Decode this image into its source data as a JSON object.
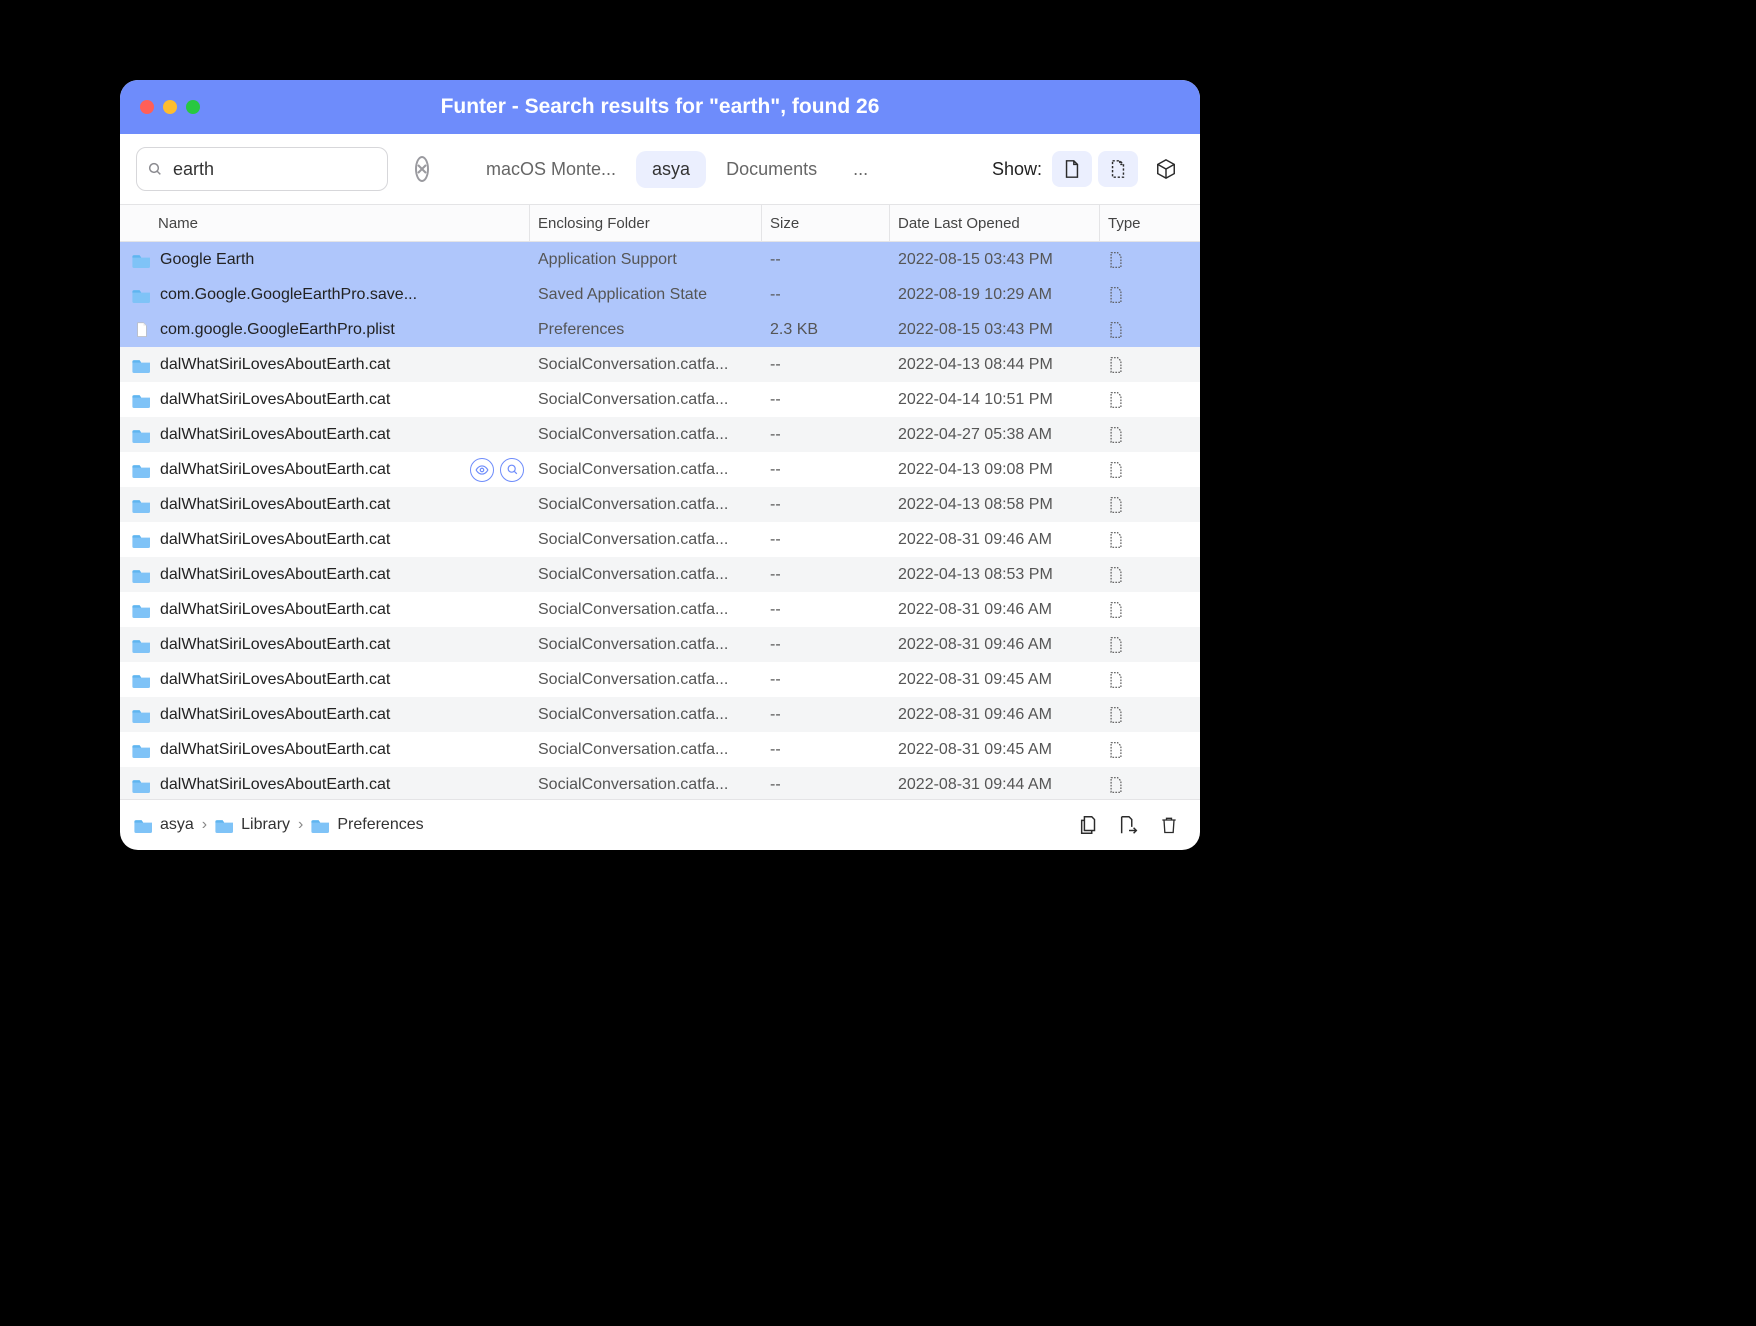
{
  "window": {
    "title": "Funter - Search results for \"earth\", found 26"
  },
  "toolbar": {
    "search_value": "earth",
    "scopes": [
      "macOS Monte...",
      "asya",
      "Documents",
      "..."
    ],
    "active_scope_index": 1,
    "show_label": "Show:"
  },
  "columns": {
    "name": "Name",
    "folder": "Enclosing Folder",
    "size": "Size",
    "date": "Date Last Opened",
    "type": "Type"
  },
  "rows": [
    {
      "icon": "folder",
      "type_icon": "hidden",
      "name": "Google Earth",
      "folder": "Application Support",
      "size": "--",
      "date": "2022-08-15 03:43 PM",
      "selected": true
    },
    {
      "icon": "folder",
      "type_icon": "hidden",
      "name": "com.Google.GoogleEarthPro.save...",
      "folder": "Saved Application State",
      "size": "--",
      "date": "2022-08-19 10:29 AM",
      "selected": true
    },
    {
      "icon": "doc",
      "type_icon": "hidden",
      "name": "com.google.GoogleEarthPro.plist",
      "folder": "Preferences",
      "size": "2.3 KB",
      "date": "2022-08-15 03:43 PM",
      "selected": true
    },
    {
      "icon": "folder",
      "type_icon": "hidden",
      "name": "dalWhatSiriLovesAboutEarth.cat",
      "folder": "SocialConversation.catfa...",
      "size": "--",
      "date": "2022-04-13 08:44 PM"
    },
    {
      "icon": "folder",
      "type_icon": "hidden",
      "name": "dalWhatSiriLovesAboutEarth.cat",
      "folder": "SocialConversation.catfa...",
      "size": "--",
      "date": "2022-04-14 10:51 PM"
    },
    {
      "icon": "folder",
      "type_icon": "hidden",
      "name": "dalWhatSiriLovesAboutEarth.cat",
      "folder": "SocialConversation.catfa...",
      "size": "--",
      "date": "2022-04-27 05:38 AM"
    },
    {
      "icon": "folder",
      "type_icon": "hidden",
      "name": "dalWhatSiriLovesAboutEarth.cat",
      "folder": "SocialConversation.catfa...",
      "size": "--",
      "date": "2022-04-13 09:08 PM",
      "hover": true
    },
    {
      "icon": "folder",
      "type_icon": "hidden",
      "name": "dalWhatSiriLovesAboutEarth.cat",
      "folder": "SocialConversation.catfa...",
      "size": "--",
      "date": "2022-04-13 08:58 PM"
    },
    {
      "icon": "folder",
      "type_icon": "hidden",
      "name": "dalWhatSiriLovesAboutEarth.cat",
      "folder": "SocialConversation.catfa...",
      "size": "--",
      "date": "2022-08-31 09:46 AM"
    },
    {
      "icon": "folder",
      "type_icon": "hidden",
      "name": "dalWhatSiriLovesAboutEarth.cat",
      "folder": "SocialConversation.catfa...",
      "size": "--",
      "date": "2022-04-13 08:53 PM"
    },
    {
      "icon": "folder",
      "type_icon": "hidden",
      "name": "dalWhatSiriLovesAboutEarth.cat",
      "folder": "SocialConversation.catfa...",
      "size": "--",
      "date": "2022-08-31 09:46 AM"
    },
    {
      "icon": "folder",
      "type_icon": "hidden",
      "name": "dalWhatSiriLovesAboutEarth.cat",
      "folder": "SocialConversation.catfa...",
      "size": "--",
      "date": "2022-08-31 09:46 AM"
    },
    {
      "icon": "folder",
      "type_icon": "hidden",
      "name": "dalWhatSiriLovesAboutEarth.cat",
      "folder": "SocialConversation.catfa...",
      "size": "--",
      "date": "2022-08-31 09:45 AM"
    },
    {
      "icon": "folder",
      "type_icon": "hidden",
      "name": "dalWhatSiriLovesAboutEarth.cat",
      "folder": "SocialConversation.catfa...",
      "size": "--",
      "date": "2022-08-31 09:46 AM"
    },
    {
      "icon": "folder",
      "type_icon": "hidden",
      "name": "dalWhatSiriLovesAboutEarth.cat",
      "folder": "SocialConversation.catfa...",
      "size": "--",
      "date": "2022-08-31 09:45 AM"
    },
    {
      "icon": "folder",
      "type_icon": "hidden",
      "name": "dalWhatSiriLovesAboutEarth.cat",
      "folder": "SocialConversation.catfa...",
      "size": "--",
      "date": "2022-08-31 09:44 AM"
    }
  ],
  "breadcrumbs": [
    "asya",
    "Library",
    "Preferences"
  ]
}
